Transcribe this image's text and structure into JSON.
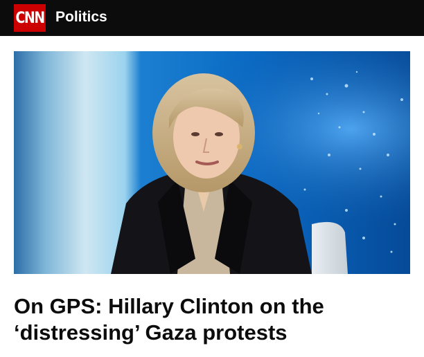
{
  "header": {
    "logo_text": "CNN",
    "section": "Politics",
    "background_color": "#0c0c0c",
    "logo_color": "#cc0000"
  },
  "article": {
    "image_alt": "Hillary Clinton seated in a TV studio in front of a blue map backdrop",
    "headline": "On GPS: Hillary Clinton on the ‘distressing’ Gaza protests"
  }
}
